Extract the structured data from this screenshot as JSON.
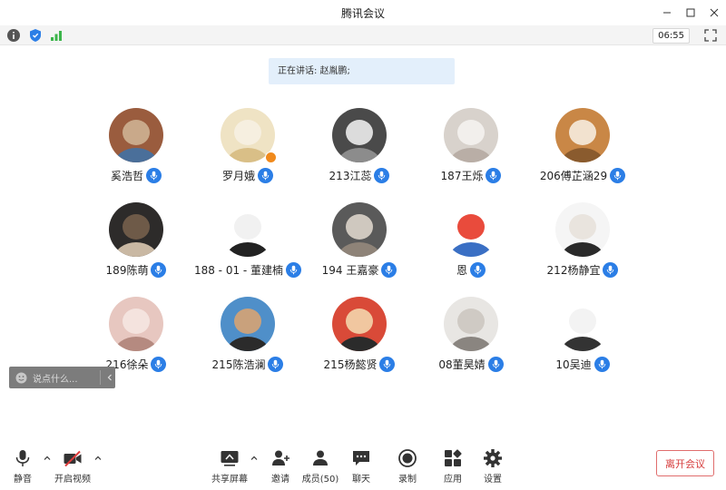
{
  "window": {
    "title": "腾讯会议"
  },
  "statusbar": {
    "timer": "06:55"
  },
  "speaking": {
    "text": "正在讲话: 赵胤鹏;"
  },
  "participants": [
    {
      "name": "奚浩哲",
      "colors": [
        "#9a5c3e",
        "#c9a98a",
        "#4a6f9a"
      ]
    },
    {
      "name": "罗月娥",
      "colors": [
        "#efe3c4",
        "#f6efe0",
        "#d9bf87"
      ],
      "host": true
    },
    {
      "name": "213江蕊",
      "colors": [
        "#4a4a4a",
        "#dcdcdc",
        "#8c8c8c"
      ]
    },
    {
      "name": "187王烁",
      "colors": [
        "#d8d2cc",
        "#f2efec",
        "#b9aea6"
      ]
    },
    {
      "name": "206傅芷涵29",
      "colors": [
        "#c98746",
        "#f2e2cf",
        "#8a5b2e"
      ]
    },
    {
      "name": "189陈萌",
      "colors": [
        "#2d2b2a",
        "#6e5a48",
        "#c9b8a3"
      ]
    },
    {
      "name": "188 - 01 - 董建楠",
      "colors": [
        "#ffffff",
        "#f1f1f1",
        "#222222"
      ]
    },
    {
      "name": "194 王嘉豪",
      "colors": [
        "#5a5a5a",
        "#cfc8bf",
        "#8e8378"
      ]
    },
    {
      "name": "恩",
      "colors": [
        "#ffffff",
        "#e94b3c",
        "#3a6fc4"
      ]
    },
    {
      "name": "212杨静宜",
      "colors": [
        "#f5f5f5",
        "#e9e4de",
        "#2a2a2a"
      ]
    },
    {
      "name": "216徐朵",
      "colors": [
        "#e7c7c0",
        "#f4e3de",
        "#b58a80"
      ]
    },
    {
      "name": "215陈浩澜",
      "colors": [
        "#4f8fc9",
        "#c9a17c",
        "#2b2b2b"
      ]
    },
    {
      "name": "215杨懿贤",
      "colors": [
        "#d94a38",
        "#f1c7a0",
        "#2b2b2b"
      ]
    },
    {
      "name": "08董昊婧",
      "colors": [
        "#e8e6e3",
        "#cfcac4",
        "#8a8580"
      ]
    },
    {
      "name": "10吴迪",
      "colors": [
        "#ffffff",
        "#f3f3f3",
        "#333333"
      ]
    }
  ],
  "chat": {
    "placeholder": "说点什么..."
  },
  "toolbar": {
    "mute": "静音",
    "video": "开启视频",
    "share": "共享屏幕",
    "invite": "邀请",
    "members": "成员(50)",
    "chat": "聊天",
    "record": "录制",
    "apps": "应用",
    "settings": "设置",
    "leave": "离开会议"
  }
}
